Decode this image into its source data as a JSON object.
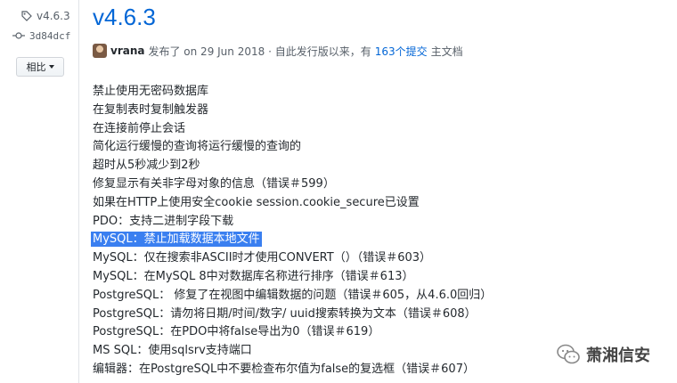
{
  "sidebar": {
    "tag_icon": "tag-icon",
    "tag_label": "v4.6.3",
    "commit_icon": "git-commit-icon",
    "commit_hash": "3d84dcf",
    "compare_label": "相比",
    "compare_caret_icon": "caret-down-icon"
  },
  "release": {
    "title": "v4.6.3",
    "author": "vrana",
    "published": "发布了 on 29 Jun 2018 · 自此发行版以来，有",
    "commits_link": "163个提交",
    "commits_suffix": "主文档",
    "notes": [
      "禁止使用无密码数据库",
      "在复制表时复制触发器",
      "在连接前停止会话",
      "简化运行缓慢的查询将运行缓慢的查询的",
      "超时从5秒减少到2秒",
      "修复显示有关非字母对象的信息（错误＃599）",
      "如果在HTTP上使用安全cookie session.cookie_secure已设置",
      "PDO：支持二进制字段下载",
      "MySQL：禁止加载数据本地文件",
      "MySQL：仅在搜索非ASCII时才使用CONVERT（）（错误＃603）",
      "MySQL：在MySQL 8中对数据库名称进行排序（错误＃613）",
      "PostgreSQL： 修复了在视图中编辑数据的问题（错误＃605，从4.6.0回归）",
      "PostgreSQL：请勿将日期/时间/数字/ uuid搜索转换为文本（错误＃608）",
      "PostgreSQL：在PDO中将false导出为0（错误＃619）",
      "MS SQL：使用sqlsrv支持端口",
      "编辑器：在PostgreSQL中不要检查布尔值为false的复选框（错误＃607）"
    ],
    "highlighted_note_index": 8
  },
  "watermark": {
    "icon": "wechat-icon",
    "text": "萧湘信安"
  },
  "colors": {
    "link": "#0366d6",
    "highlight": "#3a7ff0"
  }
}
